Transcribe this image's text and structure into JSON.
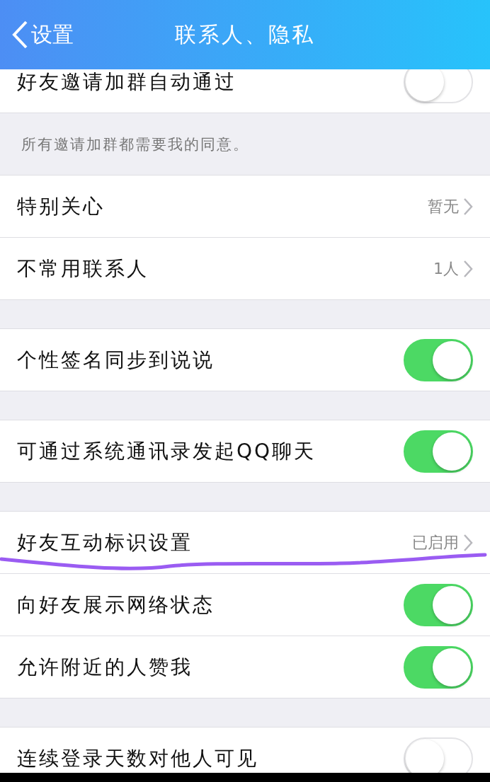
{
  "header": {
    "back_label": "设置",
    "title": "联系人、隐私"
  },
  "sections": [
    {
      "items": [
        {
          "kind": "toggle",
          "label": "好友邀请加群自动通过",
          "on": false
        }
      ],
      "footer": "所有邀请加群都需要我的同意。"
    },
    {
      "items": [
        {
          "kind": "link",
          "label": "特别关心",
          "value": "暂无"
        },
        {
          "kind": "link",
          "label": "不常用联系人",
          "value": "1人"
        }
      ]
    },
    {
      "items": [
        {
          "kind": "toggle",
          "label": "个性签名同步到说说",
          "on": true
        }
      ]
    },
    {
      "items": [
        {
          "kind": "toggle",
          "label": "可通过系统通讯录发起QQ聊天",
          "on": true
        }
      ]
    },
    {
      "items": [
        {
          "kind": "link",
          "label": "好友互动标识设置",
          "value": "已启用"
        },
        {
          "kind": "toggle",
          "label": "向好友展示网络状态",
          "on": true
        },
        {
          "kind": "toggle",
          "label": "允许附近的人赞我",
          "on": true
        }
      ]
    },
    {
      "items": [
        {
          "kind": "toggle",
          "label": "连续登录天数对他人可见",
          "on": false
        }
      ]
    }
  ]
}
